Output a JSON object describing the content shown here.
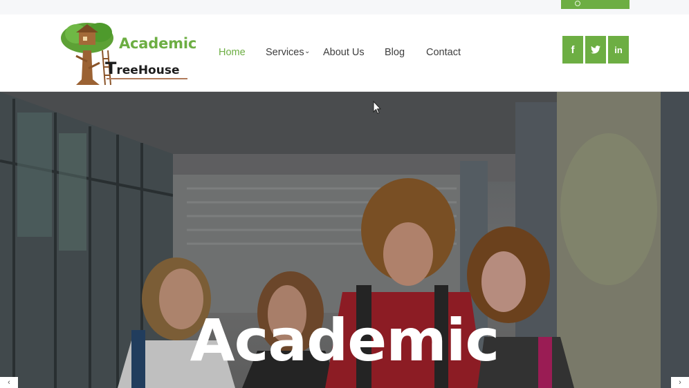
{
  "brand": {
    "line1": "Academic",
    "line2_cap": "T",
    "line2_rest": "reeHouse"
  },
  "nav": {
    "items": [
      {
        "label": "Home",
        "active": true
      },
      {
        "label": "Services",
        "has_dropdown": true
      },
      {
        "label": "About Us"
      },
      {
        "label": "Blog"
      },
      {
        "label": "Contact"
      }
    ]
  },
  "social": {
    "facebook": "f",
    "twitter": "t",
    "linkedin": "in"
  },
  "hero": {
    "title": "Academic",
    "prev_label": "‹",
    "next_label": "›"
  },
  "colors": {
    "accent": "#6dae43",
    "nav_text": "#3d3d3d",
    "hero_title": "#ffffff"
  },
  "icons": {
    "facebook": "facebook-icon",
    "twitter": "twitter-icon",
    "linkedin": "linkedin-icon"
  }
}
